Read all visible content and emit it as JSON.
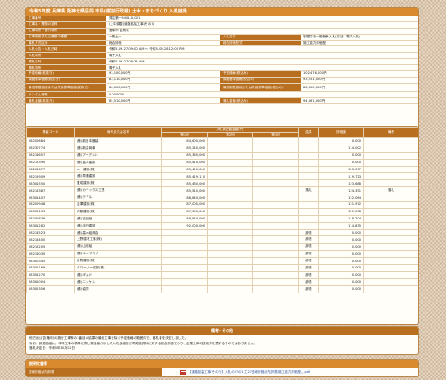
{
  "header": {
    "title": "令和5年度 兵庫県 阪神北県民局 本局(縦割行政避) 土木・まちづくり 入札結果"
  },
  "info": {
    "rows": [
      {
        "label": "工事番号",
        "value": "発注第一5401-0-001"
      },
      {
        "label": "工事名・業務の名称",
        "value": "(上中調整)道路拡幅工事(その7)"
      },
      {
        "label": "工事場所・履行場所",
        "value": "宝塚市 金鳥北"
      },
      {
        "label": "工事種別または業務の種類",
        "value": "一般土木",
        "label2": "入札方式",
        "value2": "制限付き一般競争入札(方法：電子入札)"
      },
      {
        "label": "落札方式区分",
        "value": "総合評価",
        "label2": "総合評価型式",
        "value2": "施工能力評価型"
      },
      {
        "label": "入札公告・入札日時",
        "value": "令和5-09-27 09:00 AM ～ 令和5-09-28 12:00 PM"
      },
      {
        "label": "入札場所",
        "value": "電子入札"
      },
      {
        "label": "開札日時",
        "value": "令和5-09-27 09:34 AM"
      },
      {
        "label": "開札場所",
        "value": "電子入札"
      },
      {
        "label": "予定価格(税抜き)",
        "value": "93,100,000円",
        "label2": "予定価格(税込み)",
        "value2": "102,476,000円"
      },
      {
        "label": "調査基準価格(税抜き)",
        "value": "83,110,000円",
        "label2": "調査基準価格(税込み)",
        "value2": "93,951,000円"
      },
      {
        "label": "最低制限価格または失格基準価格(税抜き)",
        "value": "86,000,000円",
        "label2": "最低制限価格または失格基準価格(税込み)",
        "value2": "86,000,000円"
      },
      {
        "label": "ランダム係数",
        "value": "0.000000"
      },
      {
        "label": "落札金額(税抜き)",
        "value": "85,510,000円",
        "label2": "落札金額(税込み)",
        "value2": "94,061,000円"
      }
    ]
  },
  "bids": {
    "headers": {
      "code": "業者コード",
      "name": "商号または名称",
      "amount_group": "入札書記載金額(円)",
      "r1": "第1回",
      "r2": "第2回",
      "r3": "第3回",
      "result": "結果",
      "score": "評価値",
      "note": "備考"
    },
    "rows": [
      {
        "code": "28200684",
        "name": "(株)新日本舗装",
        "r1": "84,600,000",
        "r2": "",
        "r3": "",
        "result": "",
        "score": "0.000",
        "note": ""
      },
      {
        "code": "28230774",
        "name": "(株)新井商事",
        "r1": "85,240,000",
        "r2": "",
        "r3": "",
        "result": "",
        "score": "114.002",
        "note": ""
      },
      {
        "code": "28214657",
        "name": "(株)アーデント",
        "r1": "85,360,000",
        "r2": "",
        "r3": "",
        "result": "",
        "score": "0.000",
        "note": ""
      },
      {
        "code": "28212390",
        "name": "(株)富本建設",
        "r1": "85,410,000",
        "r2": "",
        "r3": "",
        "result": "",
        "score": "0.000",
        "note": ""
      },
      {
        "code": "28203677",
        "name": "水一建設(株)",
        "r1": "85,410,000",
        "r2": "",
        "r3": "",
        "result": "",
        "score": "123.577",
        "note": ""
      },
      {
        "code": "28215909",
        "name": "(株)寿通建設",
        "r1": "85,419,110",
        "r2": "",
        "r3": "",
        "result": "",
        "score": "119.723",
        "note": ""
      },
      {
        "code": "28301550",
        "name": "豊成建設(株)",
        "r1": "85,430,000",
        "r2": "",
        "r3": "",
        "result": "",
        "score": "123.688",
        "note": ""
      },
      {
        "code": "28216387",
        "name": "(株)カテックス工業",
        "r1": "85,510,000",
        "r2": "",
        "r3": "",
        "result": "落札",
        "score": "124.351",
        "note": "落札"
      },
      {
        "code": "28301407",
        "name": "(株)テアル",
        "r1": "86,640,000",
        "r2": "",
        "r3": "",
        "result": "",
        "score": "122.064",
        "note": ""
      },
      {
        "code": "28200948",
        "name": "金澤建設(株)",
        "r1": "87,000,000",
        "r2": "",
        "r3": "",
        "result": "",
        "score": "121.972",
        "note": ""
      },
      {
        "code": "28300133",
        "name": "伊藤建設(株)",
        "r1": "87,000,000",
        "r2": "",
        "r3": "",
        "result": "",
        "score": "121.038",
        "note": ""
      },
      {
        "code": "28201836",
        "name": "(株)吉田組",
        "r1": "89,940,000",
        "r2": "",
        "r3": "",
        "result": "",
        "score": "118.704",
        "note": ""
      },
      {
        "code": "28301282",
        "name": "(株)半田建設",
        "r1": "92,000,000",
        "r2": "",
        "r3": "",
        "result": "",
        "score": "114.835",
        "note": ""
      },
      {
        "code": "28214523",
        "name": "(株)高木組商会",
        "r1": "",
        "r2": "",
        "r3": "",
        "result": "辞退",
        "score": "0.000",
        "note": ""
      },
      {
        "code": "28214400",
        "name": "上野運材工業(株)",
        "r1": "",
        "r2": "",
        "r3": "",
        "result": "辞退",
        "score": "0.000",
        "note": ""
      },
      {
        "code": "28215205",
        "name": "(株)山村組",
        "r1": "",
        "r2": "",
        "r3": "",
        "result": "辞退",
        "score": "0.000",
        "note": ""
      },
      {
        "code": "28216030",
        "name": "(株)ユニライフ",
        "r1": "",
        "r2": "",
        "r3": "",
        "result": "辞退",
        "score": "0.000",
        "note": ""
      },
      {
        "code": "28300345",
        "name": "日興建設(株)",
        "r1": "",
        "r2": "",
        "r3": "",
        "result": "辞退",
        "score": "0.000",
        "note": ""
      },
      {
        "code": "28301169",
        "name": "グローリー建設(株)",
        "r1": "",
        "r2": "",
        "r3": "",
        "result": "辞退",
        "score": "0.000",
        "note": ""
      },
      {
        "code": "28301270",
        "name": "(株)ギルド",
        "r1": "",
        "r2": "",
        "r3": "",
        "result": "辞退",
        "score": "0.000",
        "note": ""
      },
      {
        "code": "28301004",
        "name": "(株)ニシケン",
        "r1": "",
        "r2": "",
        "r3": "",
        "result": "辞退",
        "score": "0.000",
        "note": ""
      },
      {
        "code": "28302356",
        "name": "(株)協栄",
        "r1": "",
        "r2": "",
        "r3": "",
        "result": "辞退",
        "score": "0.000",
        "note": ""
      }
    ]
  },
  "remarks": {
    "title": "備考・その他",
    "lines": [
      "他方面公告(権利)の施行工事等の1番目の結果の最低工事を除く予定価格の範囲内で、落札者を決定しました。",
      "なお、辞退価格は、本件工事の積算に際し発注者が示した入札価格及び同実施資料に対する総合評価であり、企業全体の技術力を意するものではありません。",
      "落札決定日：令和5年10月10日"
    ]
  },
  "docs": {
    "title": "説明文書等",
    "label": "技術評価点内訳書",
    "file": "【道路拡幅工事(その7)】入札の2?の1.工2?技術評価点内訳書(施工能力評価型)_.pdf"
  },
  "colors": {
    "header": "#d98a2f",
    "label_bg": "#b86f1f",
    "border": "#b9874a",
    "background": "#e6d6c2"
  }
}
